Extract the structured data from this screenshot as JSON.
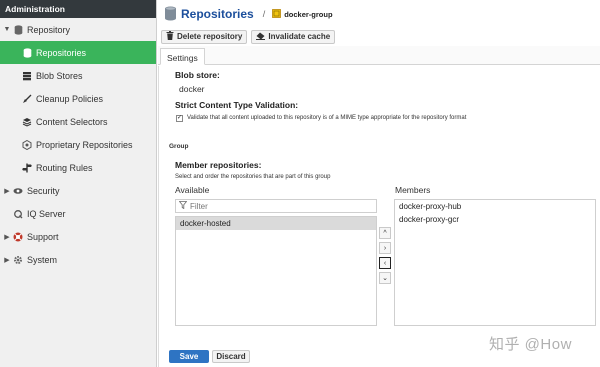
{
  "sidebar": {
    "header": "Administration",
    "items": [
      {
        "label": "Repository",
        "icon": "database-icon"
      },
      {
        "label": "Repositories",
        "icon": "database-icon"
      },
      {
        "label": "Blob Stores",
        "icon": "server-icon"
      },
      {
        "label": "Cleanup Policies",
        "icon": "broom-icon"
      },
      {
        "label": "Content Selectors",
        "icon": "layers-icon"
      },
      {
        "label": "Proprietary Repositories",
        "icon": "hexagon-icon"
      },
      {
        "label": "Routing Rules",
        "icon": "route-icon"
      },
      {
        "label": "Security",
        "icon": "eye-icon"
      },
      {
        "label": "IQ Server",
        "icon": "iq-icon"
      },
      {
        "label": "Support",
        "icon": "support-icon"
      },
      {
        "label": "System",
        "icon": "gear-icon"
      }
    ]
  },
  "header": {
    "title": "Repositories",
    "separator": "/",
    "subtitle": "docker-group"
  },
  "toolbar": {
    "delete_label": "Delete repository",
    "invalidate_label": "Invalidate cache"
  },
  "tabs": [
    "Settings"
  ],
  "form": {
    "blob_store_label": "Blob store:",
    "blob_store_value": "docker",
    "strict_label": "Strict Content Type Validation:",
    "strict_text": "Validate that all content uploaded to this repository is of a MIME type appropriate for the repository format",
    "group_section": "Group",
    "member_label": "Member repositories:",
    "member_help": "Select and order the repositories that are part of this group",
    "available_label": "Available",
    "members_label": "Members",
    "filter_placeholder": "Filter",
    "available": [
      "docker-hosted"
    ],
    "members": [
      "docker-proxy-hub",
      "docker-proxy-gcr"
    ]
  },
  "buttons": {
    "save": "Save",
    "discard": "Discard"
  },
  "watermark": "知乎 @How",
  "colors": {
    "accent_active": "#3ab45b",
    "title_blue": "#1c4f9c",
    "save_blue": "#2e74c3",
    "sidebar_header": "#33393d"
  }
}
